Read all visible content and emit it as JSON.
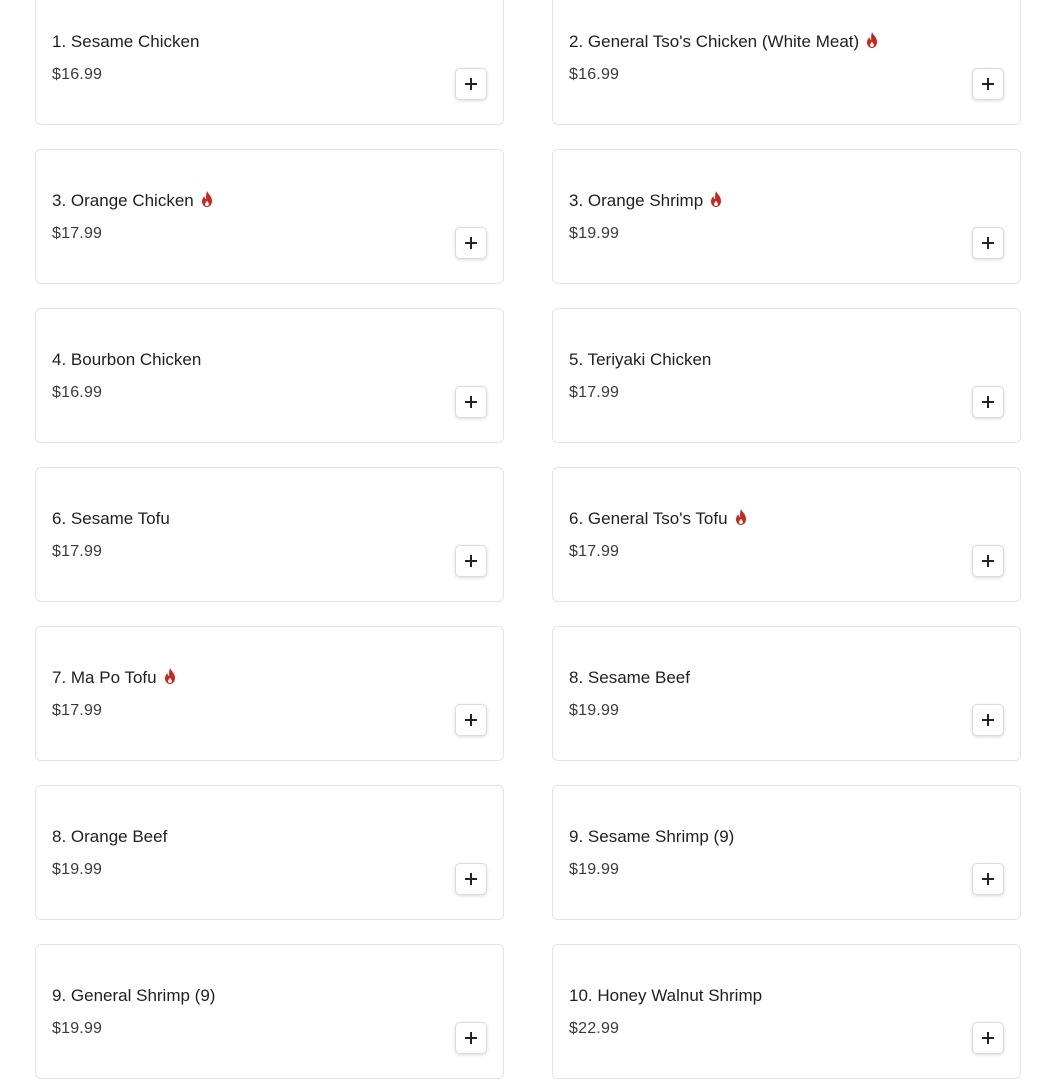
{
  "colors": {
    "spicy": "#c8281e",
    "border": "#e4e4e4"
  },
  "items": [
    {
      "title": "1. Sesame Chicken",
      "price": "$16.99",
      "spicy": false
    },
    {
      "title": "2. General Tso's Chicken (White Meat)",
      "price": "$16.99",
      "spicy": true
    },
    {
      "title": "3. Orange Chicken",
      "price": "$17.99",
      "spicy": true
    },
    {
      "title": "3. Orange Shrimp",
      "price": "$19.99",
      "spicy": true
    },
    {
      "title": "4. Bourbon Chicken",
      "price": "$16.99",
      "spicy": false
    },
    {
      "title": "5. Teriyaki Chicken",
      "price": "$17.99",
      "spicy": false
    },
    {
      "title": "6. Sesame Tofu",
      "price": "$17.99",
      "spicy": false
    },
    {
      "title": "6. General Tso's Tofu",
      "price": "$17.99",
      "spicy": true
    },
    {
      "title": "7. Ma Po Tofu",
      "price": "$17.99",
      "spicy": true
    },
    {
      "title": "8. Sesame Beef",
      "price": "$19.99",
      "spicy": false
    },
    {
      "title": "8. Orange Beef",
      "price": "$19.99",
      "spicy": false
    },
    {
      "title": "9. Sesame Shrimp (9)",
      "price": "$19.99",
      "spicy": false
    },
    {
      "title": "9. General Shrimp (9)",
      "price": "$19.99",
      "spicy": false
    },
    {
      "title": "10. Honey Walnut Shrimp",
      "price": "$22.99",
      "spicy": false
    }
  ],
  "icons": {
    "spicy": "flame-icon",
    "add": "plus-icon"
  }
}
